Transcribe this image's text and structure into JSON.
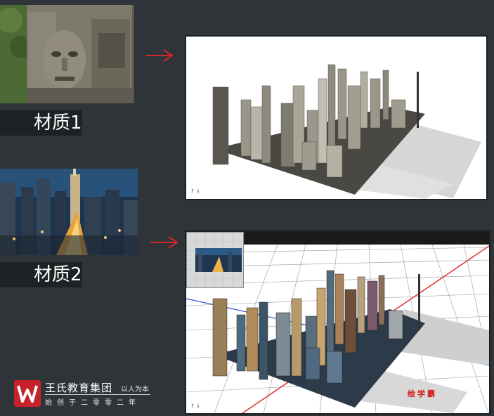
{
  "materials": [
    {
      "label": "材质1",
      "subject": "stone-face-carving"
    },
    {
      "label": "材质2",
      "subject": "city-night-skyline"
    }
  ],
  "brand": {
    "name": "王氏教育集团",
    "slogan": "以人为本",
    "subtitle": "始创于二零零二年",
    "logo_letter": "W"
  },
  "watermark": "绘学霸",
  "colors": {
    "background": "#2e3437",
    "label_bar": "#1d2224",
    "arrow": "#d8262e",
    "logo": "#c7212a",
    "axis_red": "#e03030",
    "axis_blue": "#3050d0"
  }
}
